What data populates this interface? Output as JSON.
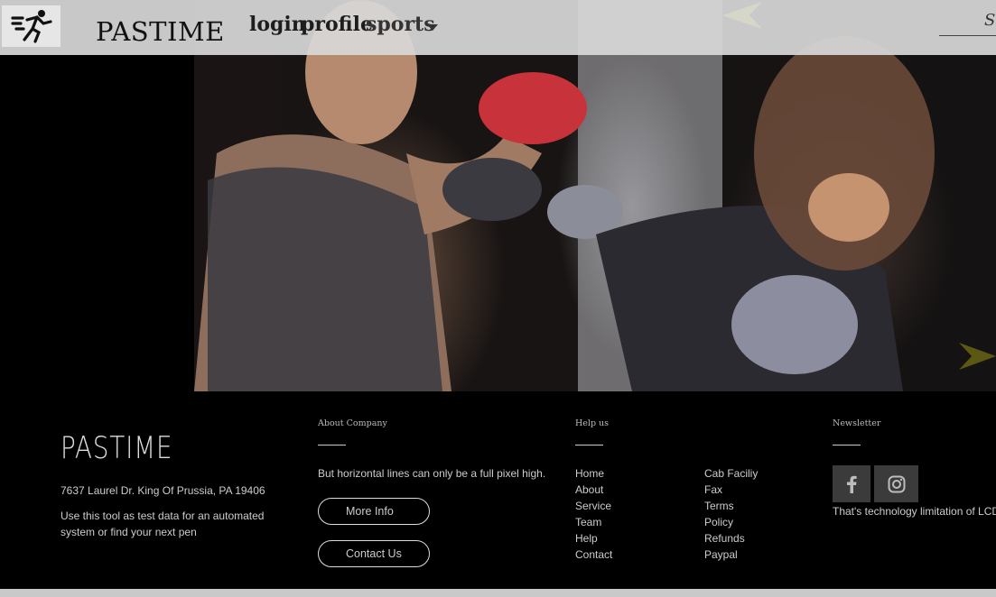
{
  "header": {
    "brand_name": "PASTIME",
    "nav": {
      "login": "login",
      "profile": "profile",
      "sports": "sports"
    },
    "search": {
      "placeholder": "Search"
    }
  },
  "hero": {
    "icon_prev": "left-arrow-icon",
    "icon_next": "right-arrow-icon"
  },
  "footer": {
    "logo": "PASTIME",
    "address": "7637 Laurel Dr. King Of Prussia, PA 19406",
    "description": "Use this tool as test data for an automated system or find your next pen",
    "about": {
      "heading": "About Company",
      "text": "But horizontal lines can only be a full pixel high.",
      "more_info": "More Info",
      "contact_us": "Contact Us"
    },
    "help": {
      "heading": "Help us",
      "col1": [
        "Home",
        "About",
        "Service",
        "Team",
        "Help",
        "Contact"
      ],
      "col2": [
        "Cab Faciliy",
        "Fax",
        "Terms",
        "Policy",
        "Refunds",
        "Paypal"
      ]
    },
    "newsletter": {
      "heading": "Newsletter",
      "text": "That's technology limitation of LCD monitors",
      "icons": [
        "facebook-icon",
        "instagram-icon"
      ]
    }
  },
  "colors": {
    "navbar_bg": "#d7d7d7",
    "footer_bg": "#000000",
    "social_bg": "#3b3b3b",
    "arrow": "#c8c21a"
  }
}
